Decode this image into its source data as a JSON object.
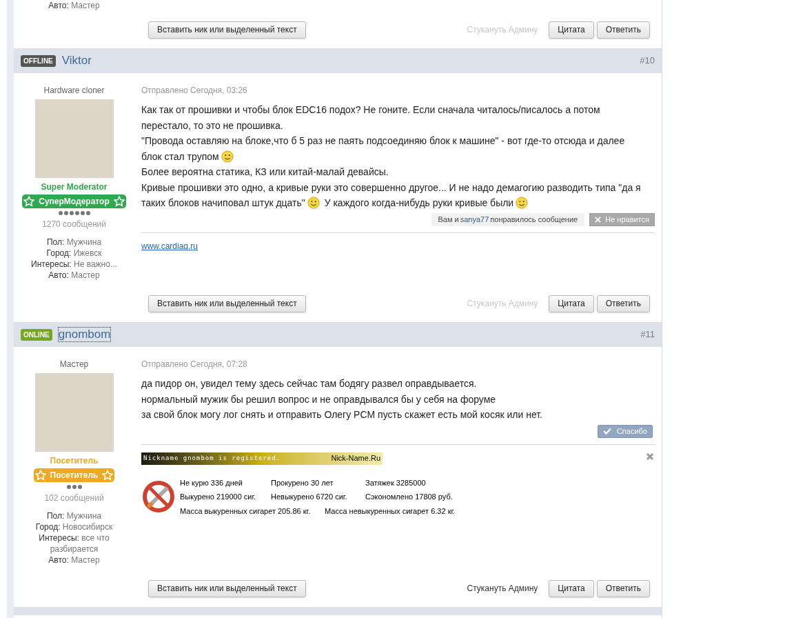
{
  "previous_post": {
    "profile_fields": [
      {
        "label": "Авто:",
        "value": "Мастер"
      }
    ],
    "footer": {
      "insert_button": "Вставить ник или выделенный текст",
      "admin_link": {
        "label": "Стукануть Админу",
        "disabled": true
      },
      "buttons": [
        "Цитата",
        "Ответить"
      ]
    }
  },
  "posts": [
    {
      "status": "OFFLINE",
      "online": false,
      "author": "Viktor",
      "focused": false,
      "number": "#10",
      "sidebar": {
        "title": "Hardware cloner",
        "rank": {
          "label": "Super Moderator",
          "badge": "СуперМодератор",
          "color": "#2fa84f"
        },
        "stars": 6,
        "posts_count": "1270 сообщений",
        "profile_fields": [
          {
            "label": "Пол:",
            "value": "Мужчина"
          },
          {
            "label": "Город:",
            "value": "Ижевск"
          },
          {
            "label": "Интересы:",
            "value": "Не важно..."
          },
          {
            "label": "Авто:",
            "value": "Мастер"
          }
        ]
      },
      "date": "Отправлено Сегодня, 03:26",
      "paragraphs": [
        [
          {
            "kind": "text",
            "text": "Как так от прошивки и чтобы блок EDC16 подох? Не гоните. Если сначала читалось/писалось а потом перестало, то это не прошивка."
          }
        ],
        [
          {
            "kind": "text",
            "text": "\"Провода оставляю на блоке,что б 5 раз не паять подсоединяю блок к машине\" - вот где-то отсюда и далее блок стал трупом"
          },
          {
            "kind": "smile"
          }
        ],
        [
          {
            "kind": "text",
            "text": "Более вероятна статика, КЗ или китай-малай девайсы."
          }
        ],
        [
          {
            "kind": "text",
            "text": "Кривые прошивки это одно, а кривые руки это совершенно другое... И не надо демагогию разводить типа \"да я таких блоков начиповал штук дцать\""
          },
          {
            "kind": "smile"
          },
          {
            "kind": "text",
            "text": "У каждого когда-нибудь руки кривые были"
          },
          {
            "kind": "wink"
          }
        ]
      ],
      "reaction": {
        "kind": "likes",
        "prefix": "Вам и",
        "user": "sanya77",
        "suffix": "понравилось сообщение",
        "button": "Не нравится"
      },
      "signature": {
        "kind": "link",
        "text": "www.cardiaq.ru"
      },
      "footer": {
        "insert_button": "Вставить ник или выделенный текст",
        "admin_link": {
          "label": "Стукануть Админу",
          "disabled": true
        },
        "buttons": [
          "Цитата",
          "Ответить"
        ]
      }
    },
    {
      "status": "ONLINE",
      "online": true,
      "author": "gnombom",
      "focused": true,
      "number": "#11",
      "sidebar": {
        "title": "Мастер",
        "rank": {
          "label": "Посетитель",
          "badge": "Посетитель",
          "color": "#f0a81c"
        },
        "stars": 3,
        "posts_count": "102 сообщений",
        "profile_fields": [
          {
            "label": "Пол:",
            "value": "Мужчина"
          },
          {
            "label": "Город:",
            "value": "Новосибирск"
          },
          {
            "label": "Интересы:",
            "value": "все что разбирается"
          },
          {
            "label": "Авто:",
            "value": "Мастер"
          }
        ]
      },
      "date": "Отправлено Сегодня, 07:28",
      "paragraphs": [
        [
          {
            "kind": "text",
            "text": "да пидор он, увидел тему здесь сейчас там бодягу развел оправдывается."
          }
        ],
        [
          {
            "kind": "text",
            "text": "нормальный мужик бы решил вопрос и не оправдывался бы у себя на форуме"
          }
        ],
        [
          {
            "kind": "text",
            "text": "за свой блок могу лог снять и отправить Олегу PCM пусть скажет есть мой косяк или нет."
          }
        ]
      ],
      "reaction": {
        "kind": "thanks",
        "button": "Спасибо"
      },
      "signature": {
        "kind": "smoking",
        "banner_text": "Nickname gnombom is registered.",
        "banner_site": "Nick-Name.Ru",
        "stats": [
          [
            "Не курю 336 дней",
            "Прокурено 30 лет",
            "Затяжек 3285000"
          ],
          [
            "Выкурено 219000 сиг.",
            "Невыкурено 6720 сиг.",
            "Сэкономлено 17808 руб."
          ],
          [
            "Масса выкуренных сигарет 205.86 кг.",
            "Масса невыкуренных сигарет 6.32 кг."
          ]
        ]
      },
      "footer": {
        "insert_button": "Вставить ник или выделенный текст",
        "admin_link": {
          "label": "Стукануть Админу",
          "disabled": false
        },
        "buttons": [
          "Цитата",
          "Ответить"
        ]
      }
    }
  ]
}
